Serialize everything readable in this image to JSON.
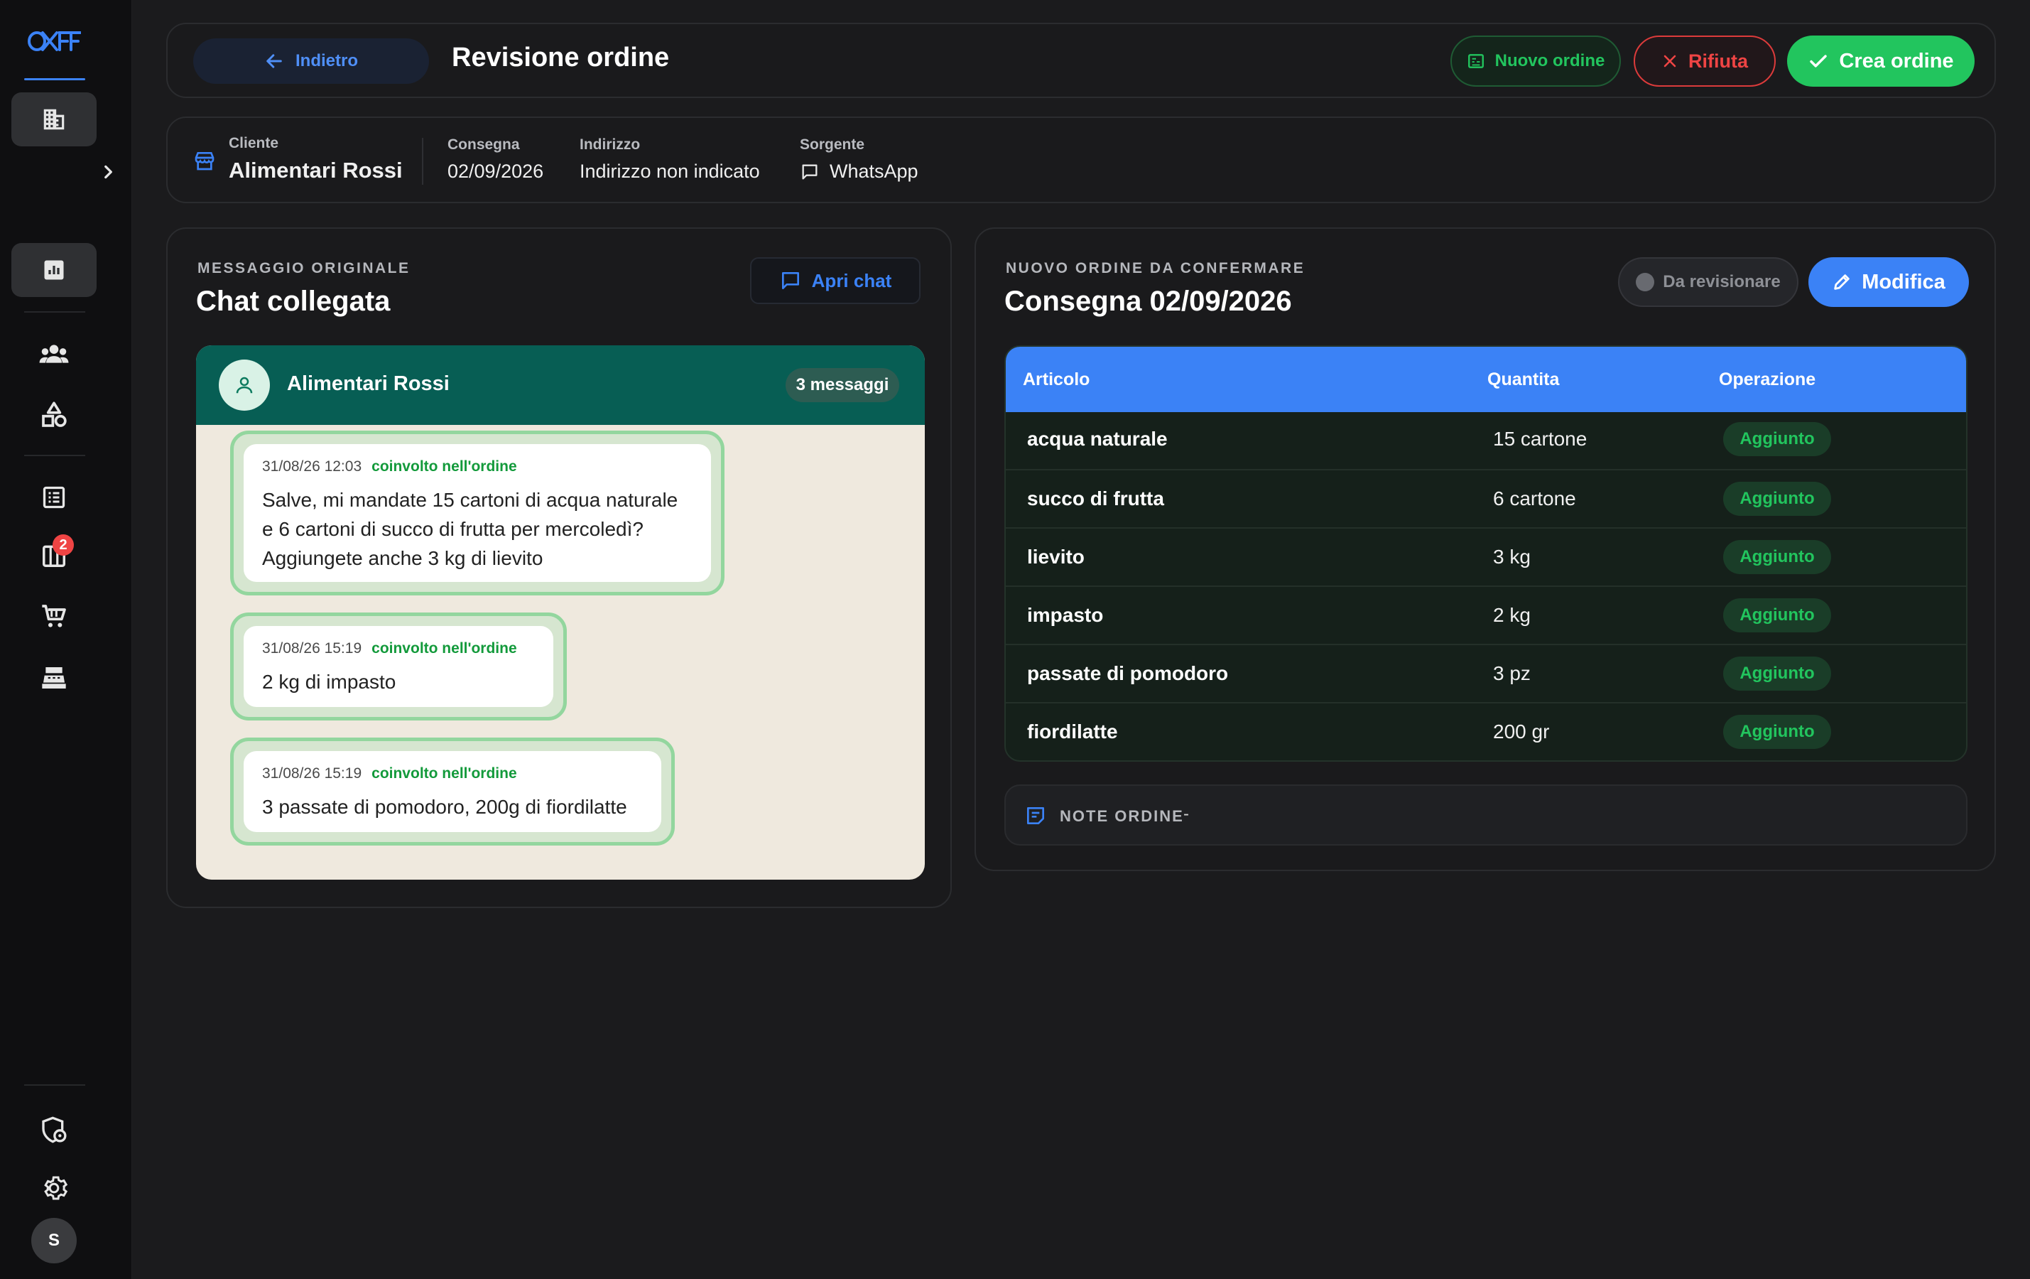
{
  "app": {
    "logo_text": "OFF"
  },
  "sidebar": {
    "items": [
      {
        "icon": "building-icon",
        "active": true
      },
      {
        "icon": "chevron-right-icon"
      },
      {
        "icon": "dashboard-chart-icon",
        "active": true
      },
      {
        "icon": "users-icon"
      },
      {
        "icon": "shapes-icon"
      },
      {
        "icon": "list-icon"
      },
      {
        "icon": "orders-board-icon",
        "badge": "2"
      },
      {
        "icon": "cart-icon"
      },
      {
        "icon": "cash-register-icon"
      },
      {
        "icon": "shield-settings-icon"
      },
      {
        "icon": "gear-icon"
      }
    ],
    "avatar_initial": "S"
  },
  "header": {
    "back_label": "Indietro",
    "title": "Revisione ordine",
    "new_order_label": "Nuovo ordine",
    "reject_label": "Rifiuta",
    "create_label": "Crea ordine"
  },
  "info": {
    "client_label": "Cliente",
    "client_value": "Alimentari Rossi",
    "delivery_label": "Consegna",
    "delivery_value": "02/09/2026",
    "address_label": "Indirizzo",
    "address_value": "Indirizzo non indicato",
    "source_label": "Sorgente",
    "source_value": "WhatsApp"
  },
  "chat_card": {
    "eyebrow": "MESSAGGIO ORIGINALE",
    "title": "Chat collegata",
    "open_chat_label": "Apri chat",
    "contact_name": "Alimentari Rossi",
    "message_count": "3 messaggi",
    "messages": [
      {
        "time": "31/08/26 12:03",
        "tag": "coinvolto nell'ordine",
        "lines": [
          "Salve, mi mandate 15 cartoni di acqua naturale",
          "e 6 cartoni di succo di frutta per mercoledì?",
          "Aggiungete anche 3 kg di lievito"
        ]
      },
      {
        "time": "31/08/26 15:19",
        "tag": "coinvolto nell'ordine",
        "lines": [
          "2 kg di impasto"
        ]
      },
      {
        "time": "31/08/26 15:19",
        "tag": "coinvolto nell'ordine",
        "lines": [
          "3 passate di pomodoro, 200g di fiordilatte"
        ]
      }
    ]
  },
  "order_card": {
    "eyebrow": "NUOVO ORDINE DA CONFERMARE",
    "title": "Consegna 02/09/2026",
    "status_label": "Da revisionare",
    "edit_label": "Modifica",
    "columns": [
      "Articolo",
      "Quantita",
      "Operazione"
    ],
    "rows": [
      {
        "name": "acqua naturale",
        "qty": "15 cartone",
        "op": "Aggiunto"
      },
      {
        "name": "succo di frutta",
        "qty": "6 cartone",
        "op": "Aggiunto"
      },
      {
        "name": "lievito",
        "qty": "3 kg",
        "op": "Aggiunto"
      },
      {
        "name": "impasto",
        "qty": "2 kg",
        "op": "Aggiunto"
      },
      {
        "name": "passate di pomodoro",
        "qty": "3 pz",
        "op": "Aggiunto"
      },
      {
        "name": "fiordilatte",
        "qty": "200 gr",
        "op": "Aggiunto"
      }
    ],
    "notes_label": "NOTE ORDINE",
    "notes_value": "-"
  },
  "colors": {
    "accent": "#3b82f6",
    "success": "#22c55e",
    "danger": "#ef4444",
    "whatsapp_header": "#075e54"
  }
}
